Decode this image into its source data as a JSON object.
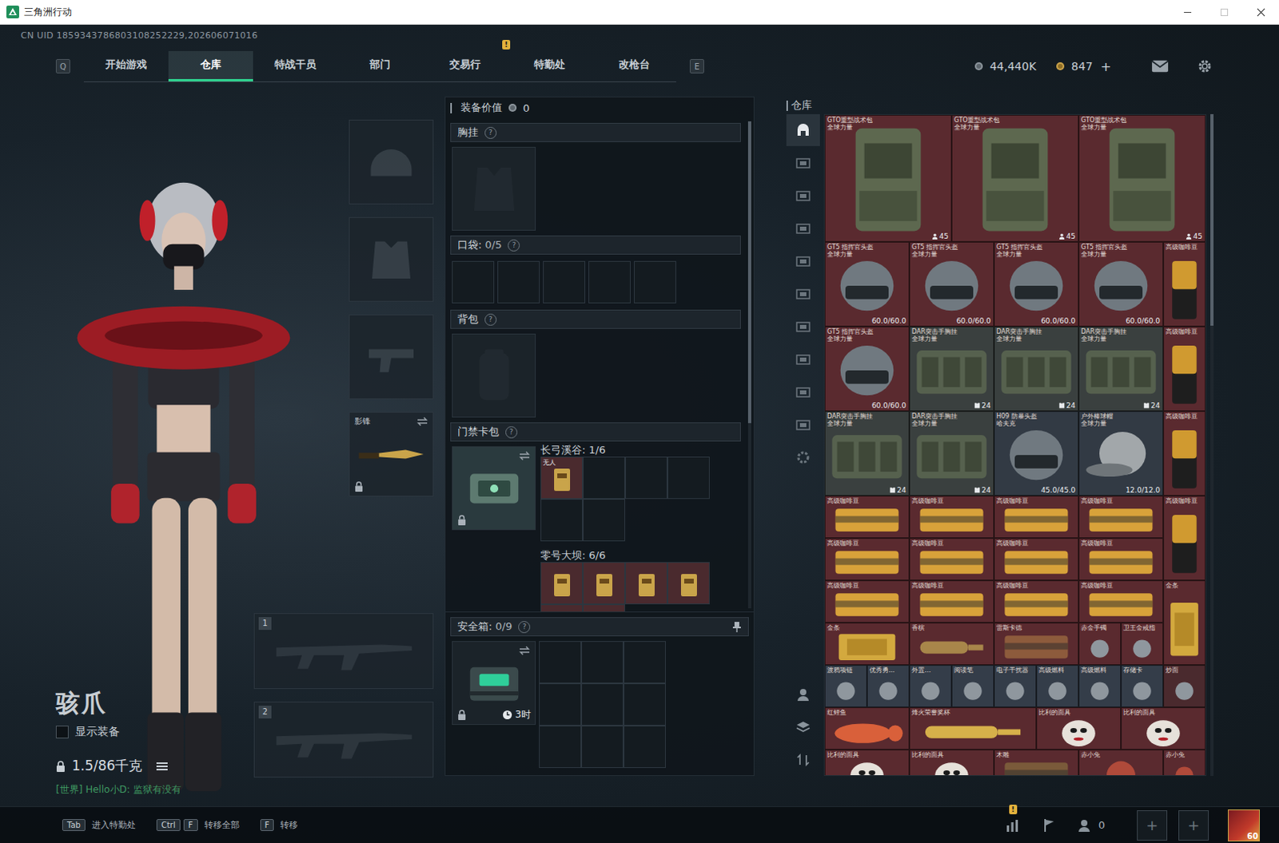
{
  "window": {
    "title": "三角洲行动"
  },
  "uid": "CN UID 1859343786803108252229,202606071016",
  "nav": {
    "prev_key": "Q",
    "next_key": "E",
    "alert_mark": "!",
    "tabs": [
      {
        "label": "开始游戏",
        "selected": false,
        "alert": false
      },
      {
        "label": "仓库",
        "selected": true,
        "alert": false
      },
      {
        "label": "特战干员",
        "selected": false,
        "alert": false
      },
      {
        "label": "部门",
        "selected": false,
        "alert": false
      },
      {
        "label": "交易行",
        "selected": false,
        "alert": false
      },
      {
        "label": "特勤处",
        "selected": false,
        "alert": true
      },
      {
        "label": "改枪台",
        "selected": false,
        "alert": false
      }
    ]
  },
  "currency": {
    "coins": "44,440K",
    "tokens": "847",
    "add": "+"
  },
  "operator": {
    "name": "骇爪",
    "show_equipment": {
      "label": "显示装备",
      "checked": false
    },
    "weight": "1.5/86千克"
  },
  "chat": {
    "channel": "[世界]",
    "sender": "Hello小D:",
    "message": "监狱有没有"
  },
  "gear_slots": [
    {
      "kind": "helmet",
      "filled": false
    },
    {
      "kind": "armor",
      "filled": false
    },
    {
      "kind": "pistol",
      "filled": false
    },
    {
      "kind": "melee",
      "filled": true,
      "label": "影锋",
      "locked": true
    }
  ],
  "weapon_slots": [
    {
      "number": "1",
      "filled": false
    },
    {
      "number": "2",
      "filled": false
    }
  ],
  "loadout": {
    "value_label": "装备价值",
    "value": "0",
    "help": "?",
    "scroll_level": 0.62,
    "chest": {
      "label": "胸挂",
      "filled": false
    },
    "pocket": {
      "label": "口袋:",
      "count": "0/5",
      "slots": [
        false,
        false,
        false,
        false,
        false
      ]
    },
    "backpack": {
      "label": "背包",
      "filled": false
    },
    "keycard": {
      "label": "门禁卡包",
      "locked": true,
      "maps": [
        {
          "name": "长弓溪谷: 1/6",
          "cards": [
            {
              "owned": true,
              "label": "无人"
            },
            {
              "owned": false
            },
            {
              "owned": false
            },
            {
              "owned": false
            },
            {
              "owned": false
            },
            {
              "owned": false
            }
          ]
        },
        {
          "name": "零号大坝: 6/6",
          "cards": [
            {
              "owned": true
            },
            {
              "owned": true
            },
            {
              "owned": true
            },
            {
              "owned": true
            },
            {
              "owned": true
            },
            {
              "owned": true
            }
          ]
        }
      ]
    },
    "safe": {
      "label": "安全箱:",
      "count": "0/9",
      "timer": "3时",
      "locked": true,
      "pinned": true,
      "slots": [
        false,
        false,
        false,
        false,
        false,
        false,
        false,
        false,
        false
      ]
    }
  },
  "warehouse": {
    "title": "仓库",
    "scroll_level": 0.32,
    "tabs": [
      {
        "selected": true
      },
      {
        "selected": false
      },
      {
        "selected": false
      },
      {
        "selected": false
      },
      {
        "selected": false
      },
      {
        "selected": false
      },
      {
        "selected": false
      },
      {
        "selected": false
      },
      {
        "selected": false
      },
      {
        "selected": false
      }
    ],
    "items": [
      {
        "kind": "backpack",
        "name": "GTO重型战术包",
        "sub": "全球力量",
        "stat": "45",
        "color": "#5a2a2f"
      },
      {
        "kind": "backpack",
        "name": "GTO重型战术包",
        "sub": "全球力量",
        "stat": "45",
        "color": "#5a2a2f"
      },
      {
        "kind": "backpack",
        "name": "GTO重型战术包",
        "sub": "全球力量",
        "stat": "45",
        "color": "#5a2a2f"
      },
      {
        "kind": "helmet",
        "name": "GT5 指挥官头盔",
        "sub": "全球力量",
        "stat": "60.0/60.0",
        "color": "#5a2a2f"
      },
      {
        "kind": "helmet",
        "name": "GT5 指挥官头盔",
        "sub": "全球力量",
        "stat": "60.0/60.0",
        "color": "#5a2a2f"
      },
      {
        "kind": "helmet",
        "name": "GT5 指挥官头盔",
        "sub": "全球力量",
        "stat": "60.0/60.0",
        "color": "#5a2a2f"
      },
      {
        "kind": "helmet",
        "name": "GT5 指挥官头盔",
        "sub": "全球力量",
        "stat": "60.0/60.0",
        "color": "#5a2a2f"
      },
      {
        "kind": "coffee-tall",
        "name": "高级咖啡豆",
        "color": "#5a2a2f"
      },
      {
        "kind": "helmet",
        "name": "GT5 指挥官头盔",
        "sub": "全球力量",
        "stat": "60.0/60.0",
        "color": "#5a2a2f"
      },
      {
        "kind": "vest",
        "name": "DAR突击手胸挂",
        "sub": "全球力量",
        "stat": "24",
        "color": "#3a403f"
      },
      {
        "kind": "vest",
        "name": "DAR突击手胸挂",
        "sub": "全球力量",
        "stat": "24",
        "color": "#3a403f"
      },
      {
        "kind": "vest",
        "name": "DAR突击手胸挂",
        "sub": "全球力量",
        "stat": "24",
        "color": "#3a403f"
      },
      {
        "kind": "coffee-tall",
        "name": "高级咖啡豆",
        "color": "#5a2a2f"
      },
      {
        "kind": "vest",
        "name": "DAR突击手胸挂",
        "sub": "全球力量",
        "stat": "24",
        "color": "#3a403f"
      },
      {
        "kind": "vest",
        "name": "DAR突击手胸挂",
        "sub": "全球力量",
        "stat": "24",
        "color": "#3a403f"
      },
      {
        "kind": "helmet",
        "name": "H09 防暴头盔",
        "sub": "哈夫克",
        "stat": "45.0/45.0",
        "color": "#323a44"
      },
      {
        "kind": "cap",
        "name": "户外棒球帽",
        "sub": "全球力量",
        "stat": "12.0/12.0",
        "color": "#323a44"
      },
      {
        "kind": "coffee-tall",
        "name": "高级咖啡豆",
        "color": "#5a2a2f"
      },
      {
        "kind": "coffee-flat",
        "name": "高级咖啡豆",
        "color": "#5a2a2f"
      },
      {
        "kind": "coffee-flat",
        "name": "高级咖啡豆",
        "color": "#5a2a2f"
      },
      {
        "kind": "coffee-flat",
        "name": "高级咖啡豆",
        "color": "#5a2a2f"
      },
      {
        "kind": "coffee-flat",
        "name": "高级咖啡豆",
        "color": "#5a2a2f"
      },
      {
        "kind": "coffee-tall",
        "name": "高级咖啡豆",
        "color": "#5a2a2f"
      },
      {
        "kind": "coffee-flat",
        "name": "高级咖啡豆",
        "color": "#5a2a2f"
      },
      {
        "kind": "coffee-flat",
        "name": "高级咖啡豆",
        "color": "#5a2a2f"
      },
      {
        "kind": "coffee-flat",
        "name": "高级咖啡豆",
        "color": "#5a2a2f"
      },
      {
        "kind": "coffee-flat",
        "name": "高级咖啡豆",
        "color": "#5a2a2f"
      },
      {
        "kind": "coffee-flat",
        "name": "高级咖啡豆",
        "color": "#5a2a2f"
      },
      {
        "kind": "coffee-flat",
        "name": "高级咖啡豆",
        "color": "#5a2a2f"
      },
      {
        "kind": "coffee-flat",
        "name": "高级咖啡豆",
        "color": "#5a2a2f"
      },
      {
        "kind": "coffee-flat",
        "name": "高级咖啡豆",
        "color": "#5a2a2f"
      },
      {
        "kind": "goldbar-tall",
        "name": "金条",
        "color": "#5a2a2f"
      },
      {
        "kind": "goldbar",
        "name": "金条",
        "color": "#5a2a2f"
      },
      {
        "kind": "bottle",
        "name": "香槟",
        "color": "#5a2a2f"
      },
      {
        "kind": "leather",
        "name": "雷斯卡德",
        "color": "#5a2a2f"
      },
      {
        "kind": "small",
        "name": "赤金手镯",
        "color": "#5a2a2f"
      },
      {
        "kind": "small",
        "name": "卫王金戒指",
        "color": "#5a2a2f"
      },
      {
        "kind": "small",
        "name": "渡鸦项链",
        "color": "#343d49"
      },
      {
        "kind": "small",
        "name": "优秀勇...",
        "color": "#343d49"
      },
      {
        "kind": "small",
        "name": "外置…",
        "color": "#343d49"
      },
      {
        "kind": "small",
        "name": "阅读笔",
        "color": "#343d49"
      },
      {
        "kind": "small",
        "name": "电子干扰器",
        "color": "#343d49"
      },
      {
        "kind": "small",
        "name": "高级燃料",
        "color": "#343d49"
      },
      {
        "kind": "small",
        "name": "高级燃料",
        "color": "#343d49"
      },
      {
        "kind": "small",
        "name": "存储卡",
        "color": "#343d49"
      },
      {
        "kind": "small",
        "name": "炒面",
        "color": "#4a2a2e"
      },
      {
        "kind": "fish",
        "name": "红鲤鱼",
        "color": "#5a2a2f"
      },
      {
        "kind": "trophy",
        "name": "烽火荣誉奖杯",
        "color": "#5a2a2f"
      },
      {
        "kind": "mask",
        "name": "比利的面具",
        "color": "#5a2a2f"
      },
      {
        "kind": "mask",
        "name": "比利的面具",
        "color": "#5a2a2f"
      },
      {
        "kind": "mask",
        "name": "比利的面具",
        "color": "#5a2a2f"
      },
      {
        "kind": "mask",
        "name": "比利的面具",
        "color": "#5a2a2f"
      },
      {
        "kind": "carving",
        "name": "木雕",
        "color": "#5a2a2f"
      },
      {
        "kind": "figurine",
        "name": "赤小兔",
        "color": "#5a2a2f"
      },
      {
        "kind": "figurine-small",
        "name": "赤小兔",
        "color": "#5a2a2f"
      }
    ]
  },
  "bottom_bar": {
    "hints": [
      {
        "keys": [
          "Tab"
        ],
        "label": "进入特勤处"
      },
      {
        "keys": [
          "Ctrl",
          "F"
        ],
        "label": "转移全部"
      },
      {
        "keys": [
          "F"
        ],
        "label": "转移"
      }
    ],
    "alert_mark": "!",
    "friends": "0",
    "add_buttons": [
      "+",
      "+"
    ],
    "level": "60"
  }
}
